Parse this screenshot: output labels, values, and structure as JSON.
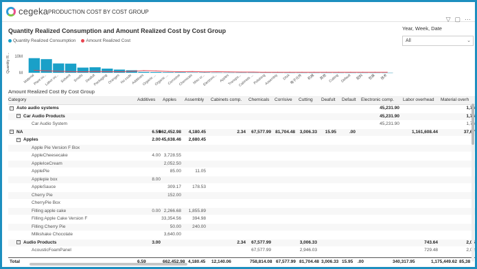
{
  "header": {
    "logo_text": "cegeka",
    "page_title": "PRODUCTION COST BY COST GROUP",
    "icons": [
      "filter-icon",
      "focus-icon",
      "more-icon"
    ]
  },
  "chart": {
    "title": "Quantity Realized Consumption and Amount Realized Cost by Cost Group",
    "legend": [
      {
        "label": "Quantity Realized Consumption",
        "color": "#1aa0c8"
      },
      {
        "label": "Amount Realized Cost",
        "color": "#e8434f"
      }
    ]
  },
  "chart_data": {
    "type": "bar",
    "ylabel": "Quantity R...",
    "yticks": [
      "10M",
      "M"
    ],
    "ylim": [
      0,
      12
    ],
    "categories": [
      "Material",
      "Plant ov...",
      "Labor ov...",
      "Solvent",
      "Smalls",
      "Deafult",
      "Packaging",
      "Oranges",
      "No code",
      "Additives",
      "Organic ...",
      "Organic ...",
      "Corrosive",
      "Chemicals",
      "Misc cr...",
      "Electroni...",
      "Apples",
      "Transpo...",
      "Cabinets ...",
      "Polishing",
      "Assembly",
      "DNA",
      "电子元件",
      "机械",
      "其他",
      "Cutting",
      "Default",
      "配料",
      "包装",
      "技术"
    ],
    "series": [
      {
        "name": "Quantity Realized Consumption",
        "values": [
          8.8,
          8.2,
          5.6,
          5.5,
          3.1,
          3.3,
          2.5,
          1.9,
          1.5,
          0.5,
          0.4,
          0.3,
          0.3,
          0.2,
          0.2,
          0.1,
          0.1,
          0.1,
          0.1,
          0.1,
          0.1,
          0.05,
          0.05,
          0.05,
          0.05,
          0.05,
          0.05,
          0.05,
          0.05,
          0.05
        ]
      },
      {
        "name": "Amount Realized Cost",
        "values": [
          1.5,
          1.2,
          0.9,
          0.7,
          0.6,
          0.8,
          0.7,
          0.6,
          0.9,
          1.3,
          1.1,
          0.8,
          0.6,
          0.7,
          0.5,
          0.6,
          0.5,
          0.4,
          0.4,
          0.3,
          0.3,
          0.3,
          0.3,
          0.3,
          0.3,
          0.3,
          0.3,
          0.3,
          0.3,
          0.3
        ]
      }
    ]
  },
  "slicer": {
    "title": "Year, Week, Date",
    "value": "All"
  },
  "table": {
    "title": "Amount Realized Cost By Cost Group",
    "columns": [
      "Category",
      "Additives",
      "Apples",
      "Assembly",
      "Cabinets comp.",
      "Chemicals",
      "Corrisive",
      "Cutting",
      "Deafult",
      "Default",
      "Electronic comp.",
      "Labor overhead",
      "Material overh"
    ],
    "rows": [
      {
        "level": 0,
        "expander": "−",
        "bold": true,
        "cells": [
          "Auto audio systems",
          "",
          "",
          "",
          "",
          "",
          "",
          "",
          "",
          "",
          "45,231.90",
          "",
          "1,76"
        ]
      },
      {
        "level": 1,
        "expander": "−",
        "bold": true,
        "cells": [
          "Car Audio Products",
          "",
          "",
          "",
          "",
          "",
          "",
          "",
          "",
          "",
          "45,231.90",
          "",
          "1,76"
        ]
      },
      {
        "level": 2,
        "expander": "",
        "bold": false,
        "cells": [
          "Car Audio System",
          "",
          "",
          "",
          "",
          "",
          "",
          "",
          "",
          "",
          "45,231.90",
          "",
          "1,76"
        ]
      },
      {
        "level": 0,
        "expander": "−",
        "bold": true,
        "cells": [
          "NA",
          "6.59",
          "662,452.98",
          "4,180.45",
          "2.34",
          "67,577.99",
          "81,704.48",
          "3,006.33",
          "15.95",
          ".00",
          "",
          "1,161,608.44",
          "37,67"
        ]
      },
      {
        "level": 1,
        "expander": "−",
        "bold": true,
        "cells": [
          "Apples",
          "2.00",
          "45,638.46",
          "2,680.45",
          "",
          "",
          "",
          "",
          "",
          "",
          "",
          "",
          ""
        ]
      },
      {
        "level": 2,
        "expander": "",
        "bold": false,
        "cells": [
          "Apple Pie Version F Box",
          "",
          "",
          "",
          "",
          "",
          "",
          "",
          "",
          "",
          "",
          "",
          ""
        ]
      },
      {
        "level": 2,
        "expander": "",
        "bold": false,
        "cells": [
          "AppleCheesecake",
          "4.00",
          "3,728.55",
          "",
          "",
          "",
          "",
          "",
          "",
          "",
          "",
          "",
          ""
        ]
      },
      {
        "level": 2,
        "expander": "",
        "bold": false,
        "cells": [
          "AppleIceCream",
          "",
          "2,052.50",
          "",
          "",
          "",
          "",
          "",
          "",
          "",
          "",
          "",
          ""
        ]
      },
      {
        "level": 2,
        "expander": "",
        "bold": false,
        "cells": [
          "ApplePie",
          "",
          "85.00",
          "11.05",
          "",
          "",
          "",
          "",
          "",
          "",
          "",
          "",
          ""
        ]
      },
      {
        "level": 2,
        "expander": "",
        "bold": false,
        "cells": [
          "Applepie box",
          "8.00",
          "",
          "",
          "",
          "",
          "",
          "",
          "",
          "",
          "",
          "",
          ""
        ]
      },
      {
        "level": 2,
        "expander": "",
        "bold": false,
        "cells": [
          "AppleSauce",
          "",
          "309.17",
          "178.53",
          "",
          "",
          "",
          "",
          "",
          "",
          "",
          "",
          ""
        ]
      },
      {
        "level": 2,
        "expander": "",
        "bold": false,
        "cells": [
          "Cherry Pie",
          "",
          "152.00",
          "",
          "",
          "",
          "",
          "",
          "",
          "",
          "",
          "",
          ""
        ]
      },
      {
        "level": 2,
        "expander": "",
        "bold": false,
        "cells": [
          "CherryPie Box",
          "",
          "",
          "",
          "",
          "",
          "",
          "",
          "",
          "",
          "",
          "",
          ""
        ]
      },
      {
        "level": 2,
        "expander": "",
        "bold": false,
        "cells": [
          "Filling apple cake",
          "0.00",
          "2,266.68",
          "1,855.89",
          "",
          "",
          "",
          "",
          "",
          "",
          "",
          "",
          ""
        ]
      },
      {
        "level": 2,
        "expander": "",
        "bold": false,
        "cells": [
          "Filling Apple Cake Version F",
          "",
          "33,354.56",
          "394.98",
          "",
          "",
          "",
          "",
          "",
          "",
          "",
          "",
          ""
        ]
      },
      {
        "level": 2,
        "expander": "",
        "bold": false,
        "cells": [
          "Filling Cherry Pie",
          "",
          "50.00",
          "240.00",
          "",
          "",
          "",
          "",
          "",
          "",
          "",
          "",
          ""
        ]
      },
      {
        "level": 2,
        "expander": "",
        "bold": false,
        "cells": [
          "Milkshake Chocolate",
          "",
          "3,640.00",
          "",
          "",
          "",
          "",
          "",
          "",
          "",
          "",
          "",
          ""
        ]
      },
      {
        "level": 1,
        "expander": "−",
        "bold": true,
        "cells": [
          "Audio Products",
          "3.00",
          "",
          "",
          "2.34",
          "67,577.99",
          "",
          "3,006.33",
          "",
          "",
          "",
          "743.64",
          "2,05"
        ]
      },
      {
        "level": 2,
        "expander": "",
        "bold": false,
        "cells": [
          "AcousticFoamPanel",
          "",
          "",
          "",
          "",
          "67,577.99",
          "",
          "2,946.03",
          "",
          "",
          "",
          "729.48",
          "2,02"
        ]
      }
    ],
    "total": [
      "Total",
      "6.59",
      "662,452.98",
      "4,180.45",
      "12,140.06",
      "758,814.08",
      "67,577.99",
      "81,704.48",
      "3,006.33",
      "15.95",
      ".00",
      "340,317.95",
      "1,175,449.62",
      "85,38"
    ]
  }
}
